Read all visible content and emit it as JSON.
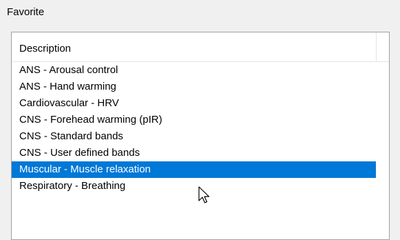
{
  "group": {
    "label": "Favorite"
  },
  "list": {
    "column_header": "Description",
    "items": [
      {
        "label": "ANS - Arousal control",
        "selected": false
      },
      {
        "label": "ANS - Hand warming",
        "selected": false
      },
      {
        "label": "Cardiovascular - HRV",
        "selected": false
      },
      {
        "label": "CNS - Forehead warming (pIR)",
        "selected": false
      },
      {
        "label": "CNS - Standard bands",
        "selected": false
      },
      {
        "label": "CNS - User defined bands",
        "selected": false
      },
      {
        "label": "Muscular - Muscle relaxation",
        "selected": true
      },
      {
        "label": "Respiratory - Breathing",
        "selected": false
      }
    ]
  },
  "colors": {
    "selection": "#0078d7",
    "background": "#f0f0f0",
    "border": "#a0a0a0"
  },
  "icons": {
    "pointer": "mouse-pointer-icon"
  }
}
